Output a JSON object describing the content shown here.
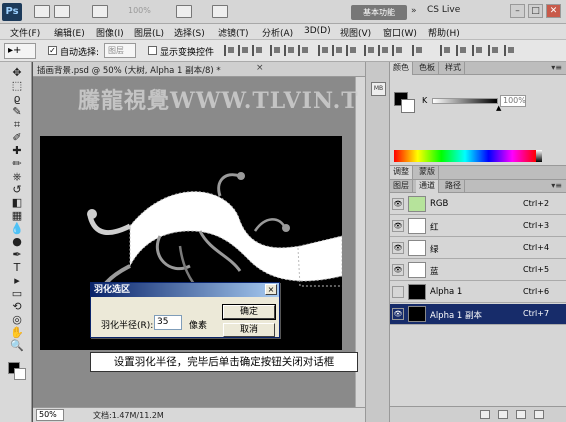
{
  "app": {
    "logo": "Ps",
    "zoom_dim": "100%",
    "workspace_button": "基本功能",
    "workspace_arrow": "»",
    "cs_live": "CS Live",
    "window_buttons": [
      "–",
      "□",
      "✕"
    ]
  },
  "menu": [
    "文件(F)",
    "编辑(E)",
    "图像(I)",
    "图层(L)",
    "选择(S)",
    "滤镜(T)",
    "分析(A)",
    "3D(D)",
    "视图(V)",
    "窗口(W)",
    "帮助(H)"
  ],
  "options": {
    "tool_preset": "▸+",
    "auto_select_checked": "✓",
    "auto_select_label": "自动选择:",
    "auto_select_value": "图层",
    "show_transform_label": "显示变换控件"
  },
  "tools": {
    "icons": [
      "move-icon",
      "marquee-icon",
      "lasso-icon",
      "quick-select-icon",
      "crop-icon",
      "eyedropper-icon",
      "healing-icon",
      "brush-icon",
      "stamp-icon",
      "history-brush-icon",
      "eraser-icon",
      "gradient-icon",
      "blur-icon",
      "dodge-icon",
      "pen-icon",
      "type-icon",
      "path-select-icon",
      "shape-icon",
      "3d-rotate-icon",
      "3d-orbit-icon",
      "hand-icon",
      "zoom-icon"
    ],
    "glyphs": [
      "✥",
      "⬚",
      "ϱ",
      "✎",
      "⌗",
      "✐",
      "✚",
      "✏",
      "⎈",
      "↺",
      "◧",
      "▦",
      "💧",
      "●",
      "✒",
      "T",
      "▸",
      "▭",
      "⟲",
      "◎",
      "✋",
      "🔍"
    ]
  },
  "document": {
    "tab_title": "插画背景.psd @ 50% (大树, Alpha 1 副本/8) *",
    "tab_close": "×",
    "zoom": "50%",
    "info": "文档:1.47M/11.2M"
  },
  "watermark": "騰龍視覺WWW.TLVIN.T",
  "dialog": {
    "title": "羽化选区",
    "close": "×",
    "radius_label": "羽化半径(R):",
    "radius_value": "35",
    "unit": "像素",
    "ok": "确定",
    "cancel": "取消"
  },
  "caption": "设置羽化半径，完毕后单击确定按钮关闭对话框",
  "strip": {
    "mini": "MB"
  },
  "color_panel": {
    "tabs": [
      "颜色",
      "色板",
      "样式"
    ],
    "menu": "▾≡",
    "channel_label": "K",
    "value": "100",
    "value_unit": "%"
  },
  "adjust_tabs": [
    "调整",
    "蒙版"
  ],
  "channels_panel": {
    "tabs": [
      "图层",
      "通道",
      "路径"
    ],
    "menu": "▾≡",
    "rows": [
      {
        "name": "RGB",
        "key": "Ctrl+2",
        "selected": false,
        "visible": true
      },
      {
        "name": "红",
        "key": "Ctrl+3",
        "selected": false,
        "visible": true
      },
      {
        "name": "绿",
        "key": "Ctrl+4",
        "selected": false,
        "visible": true
      },
      {
        "name": "蓝",
        "key": "Ctrl+5",
        "selected": false,
        "visible": true
      },
      {
        "name": "Alpha 1",
        "key": "Ctrl+6",
        "selected": false,
        "visible": false
      },
      {
        "name": "Alpha 1 副本",
        "key": "Ctrl+7",
        "selected": true,
        "visible": true
      }
    ]
  }
}
